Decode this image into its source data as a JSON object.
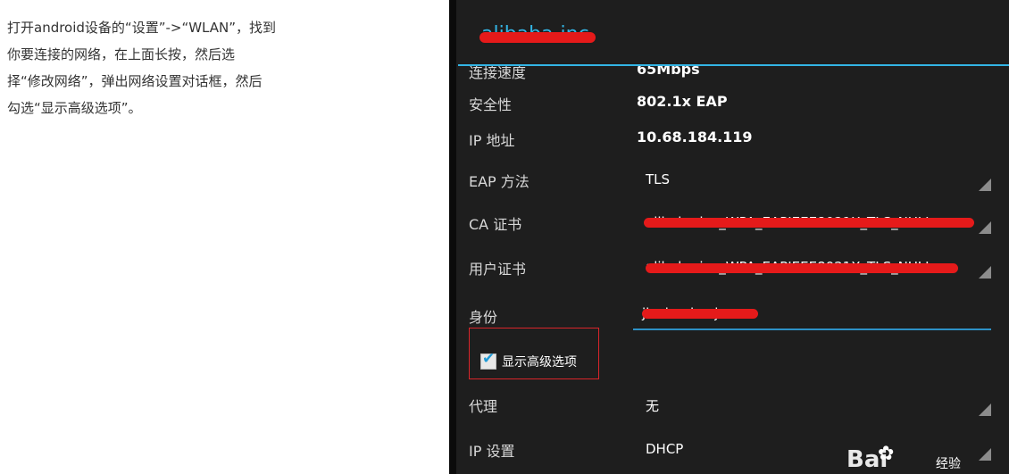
{
  "instruction": {
    "line1": "打开android设备的“设置”->“WLAN”，找到",
    "line2": "你要连接的网络，在上面长按，然后选",
    "line3": "择“修改网络”，弹出网络设置对话框，然后",
    "line4": "勾选“显示高级选项”。"
  },
  "dialog": {
    "title": "alibaba-inc",
    "rows": {
      "link_speed": {
        "label": "连接速度",
        "value": "65Mbps"
      },
      "security": {
        "label": "安全性",
        "value": "802.1x EAP"
      },
      "ip_address": {
        "label": "IP 地址",
        "value": "10.68.184.119"
      },
      "eap_method": {
        "label": "EAP 方法",
        "value": "TLS"
      },
      "ca_cert": {
        "label": "CA 证书",
        "value": "alibaba-inc_WPA_EAPIEEE8021X_TLS_NULL"
      },
      "user_cert": {
        "label": "用户证书",
        "value": "alibaba-inc_WPA_EAPIEEE8021X_TLS_NULL"
      },
      "identity": {
        "label": "身份",
        "value": "jiachuai.xujs"
      },
      "show_advanced": {
        "label": "显示高级选项",
        "checked": true
      },
      "proxy": {
        "label": "代理",
        "value": "无"
      },
      "ip_settings": {
        "label": "IP 设置",
        "value": "DHCP"
      }
    }
  },
  "watermark": {
    "brand": "Bai",
    "suffix": "经验"
  },
  "colors": {
    "accent": "#33b5e5",
    "redact": "#e51a1a",
    "highlight_box": "#d9252a",
    "screen_bg": "#1e1e1e"
  }
}
